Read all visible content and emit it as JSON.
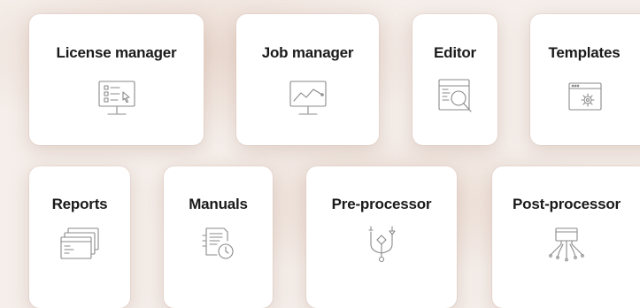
{
  "tiles": [
    {
      "label": "License manager",
      "icon": "license-monitor-icon"
    },
    {
      "label": "Job manager",
      "icon": "chart-monitor-icon"
    },
    {
      "label": "Editor",
      "icon": "code-magnifier-icon"
    },
    {
      "label": "Templates",
      "icon": "gear-window-icon"
    },
    {
      "label": "Reports",
      "icon": "stacked-windows-icon"
    },
    {
      "label": "Manuals",
      "icon": "document-clock-icon"
    },
    {
      "label": "Pre-processor",
      "icon": "flow-diagram-icon"
    },
    {
      "label": "Post-processor",
      "icon": "circuit-chip-icon"
    }
  ],
  "colors": {
    "background": "#f5eeea",
    "tile": "#ffffff",
    "label": "#1a1a1a",
    "icon_stroke": "#8a8a8a"
  }
}
